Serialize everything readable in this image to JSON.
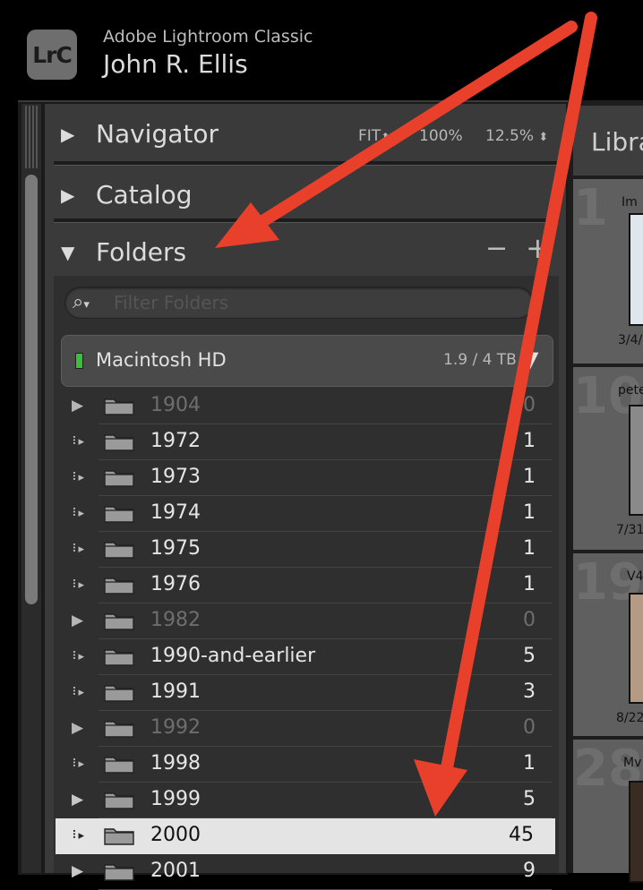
{
  "app": {
    "logo": "LrC",
    "name": "Adobe Lightroom Classic",
    "user": "John R. Ellis"
  },
  "navigator": {
    "title": "Navigator",
    "zoom_fit": "FIT",
    "zoom_100": "100%",
    "zoom_custom": "12.5%"
  },
  "catalog": {
    "title": "Catalog"
  },
  "folders": {
    "title": "Folders",
    "minus": "−",
    "plus": "+",
    "filter_placeholder": "Filter Folders",
    "volume": {
      "name": "Macintosh HD",
      "size": "1.9 / 4 TB"
    },
    "rows": [
      {
        "name": "1904",
        "count": "0"
      },
      {
        "name": "1972",
        "count": "1"
      },
      {
        "name": "1973",
        "count": "1"
      },
      {
        "name": "1974",
        "count": "1"
      },
      {
        "name": "1975",
        "count": "1"
      },
      {
        "name": "1976",
        "count": "1"
      },
      {
        "name": "1982",
        "count": "0"
      },
      {
        "name": "1990-and-earlier",
        "count": "5"
      },
      {
        "name": "1991",
        "count": "3"
      },
      {
        "name": "1992",
        "count": "0"
      },
      {
        "name": "1998",
        "count": "1"
      },
      {
        "name": "1999",
        "count": "5"
      },
      {
        "name": "2000",
        "count": "45"
      },
      {
        "name": "2001",
        "count": "9"
      }
    ]
  },
  "library": {
    "tab_label": "Libra",
    "cells": [
      {
        "num": "1",
        "caption": "Im",
        "date": "3/4/"
      },
      {
        "num": "10",
        "caption": "pete",
        "date": "7/31/"
      },
      {
        "num": "19",
        "caption": "V4",
        "date": "8/22"
      },
      {
        "num": "28",
        "caption": "Mv",
        "date": ""
      }
    ]
  },
  "colors": {
    "arrow": "#e8402a",
    "selected_row": "#e4e4e4",
    "volume_led": "#3bbf3b"
  }
}
